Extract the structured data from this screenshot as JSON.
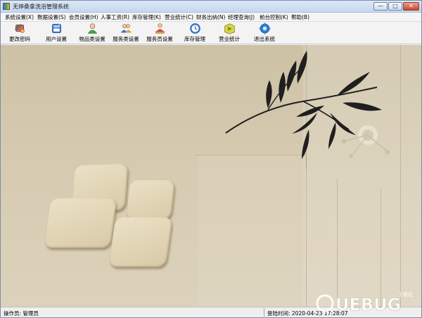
{
  "window": {
    "title": "无停桑拿洗浴管理系统"
  },
  "window_controls": {
    "minimize": "—",
    "maximize": "□",
    "close": "✕"
  },
  "menu": [
    "系统设置(X)",
    "数据设置(S)",
    "会员设置(H)",
    "人事工资(R)",
    "库存管理(K)",
    "营业统计(C)",
    "财务出纳(N)",
    "经理查询(J)",
    "前台控制(K)",
    "帮助(B)"
  ],
  "toolbar": [
    {
      "label": "更改密码",
      "icon": "key-change-password-icon"
    },
    {
      "label": "用户设置",
      "icon": "user-settings-icon"
    },
    {
      "label": "物品类设置",
      "icon": "item-category-icon"
    },
    {
      "label": "服务类设置",
      "icon": "service-category-icon"
    },
    {
      "label": "服务员设置",
      "icon": "waiter-settings-icon"
    },
    {
      "label": "库存管理",
      "icon": "inventory-clock-icon"
    },
    {
      "label": "营业统计",
      "icon": "business-stats-icon"
    },
    {
      "label": "退出系统",
      "icon": "exit-gear-icon"
    }
  ],
  "statusbar": {
    "operator": "操作员: 管理员",
    "login_time": "登陆时间: 2020-04-23 17:28:07"
  },
  "watermark": {
    "text": "UEBUG",
    "subtext": "下载站"
  },
  "colors": {
    "background_paper": "#d6cbb1",
    "tile": "#e4d8bb",
    "bamboo_ink": "#1f1f1f",
    "title_bar": "#d2e1f4"
  }
}
